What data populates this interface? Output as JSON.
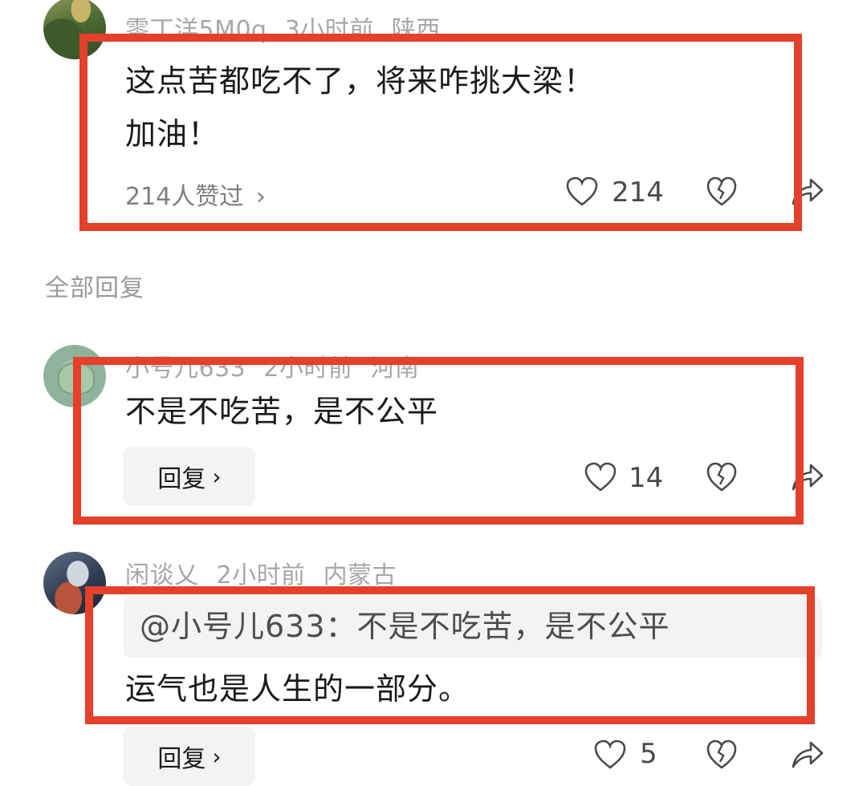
{
  "comment1": {
    "username": "零丁洋5M0q",
    "time": "3小时前",
    "location": "陕西",
    "text_line1": "这点苦都吃不了，将来咋挑大梁！",
    "text_line2": "加油！",
    "likes_summary": "214人赞过",
    "like_count": "214"
  },
  "section": {
    "all_replies": "全部回复"
  },
  "reply1": {
    "username": "小号儿633",
    "time": "2小时前",
    "location": "河南",
    "text": "不是不吃苦，是不公平",
    "reply_label": "回复",
    "like_count": "14"
  },
  "reply2": {
    "username": "闲谈乂",
    "time": "2小时前",
    "location": "内蒙古",
    "quote": "@小号儿633：不是不吃苦，是不公平",
    "text": "运气也是人生的一部分。",
    "reply_label": "回复",
    "like_count": "5"
  },
  "icons": {
    "like": "heart-outline-icon",
    "dislike": "broken-heart-icon",
    "share": "share-arrow-icon",
    "chevron": "chevron-right-icon"
  },
  "colors": {
    "highlight_box": "#e4402a",
    "meta_text": "#a7a7a7"
  }
}
